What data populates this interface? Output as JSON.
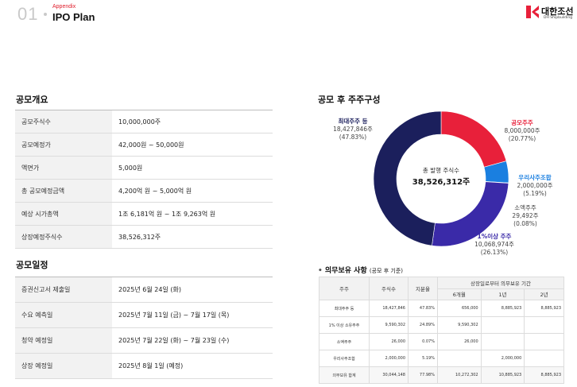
{
  "header": {
    "page_number": "01",
    "section": "Appendix",
    "title": "IPO Plan",
    "logo_kr": "대한조선",
    "logo_en": "DH Shipbuilding"
  },
  "offering": {
    "title": "공모개요",
    "rows": [
      {
        "label": "공모주식수",
        "value": "10,000,000주"
      },
      {
        "label": "공모예정가",
        "value": "42,000원 ~ 50,000원"
      },
      {
        "label": "액면가",
        "value": "5,000원"
      },
      {
        "label": "총 공모예정금액",
        "value": "4,200억 원 ~ 5,000억 원"
      },
      {
        "label": "예상 시가총액",
        "value": "1조 6,181억 원 ~ 1조 9,263억 원"
      },
      {
        "label": "상장예정주식수",
        "value": "38,526,312주"
      }
    ]
  },
  "schedule": {
    "title": "공모일정",
    "rows": [
      {
        "label": "증권신고서 제출일",
        "value": "2025년 6월 24일 (화)"
      },
      {
        "label": "수요 예측일",
        "value": "2025년 7월 11일 (금) ~ 7월 17일 (목)"
      },
      {
        "label": "청약 예정일",
        "value": "2025년 7월 22일 (화) ~ 7월 23일 (수)"
      },
      {
        "label": "상장 예정일",
        "value": "2025년 8월 1일 (예정)"
      }
    ]
  },
  "shareholding": {
    "title": "공모 후 주주구성",
    "center_label": "총 발행 주식수",
    "center_value": "38,526,312주",
    "labels": {
      "largest": {
        "name": "최대주주 등",
        "shares": "18,427,846주",
        "pct": "(47.83%)"
      },
      "public": {
        "name": "공모주주",
        "shares": "8,000,000주",
        "pct": "(20.77%)"
      },
      "esop": {
        "name": "우리사주조합",
        "shares": "2,000,000주",
        "pct": "(5.19%)"
      },
      "minority": {
        "name": "소액주주",
        "shares": "29,492주",
        "pct": "(0.08%)"
      },
      "over1": {
        "name": "1%이상 주주",
        "shares": "10,068,974주",
        "pct": "(26.13%)"
      }
    },
    "colors": {
      "largest": "#1b1f5c",
      "public": "#e8203a",
      "esop": "#1a7fe0",
      "minority": "#cfcfcf",
      "over1": "#3a2aa8"
    }
  },
  "chart_data": {
    "type": "pie",
    "title": "공모 후 주주구성",
    "categories": [
      "공모주주",
      "우리사주조합",
      "소액주주",
      "1%이상 주주",
      "최대주주 등"
    ],
    "values": [
      20.77,
      5.19,
      0.08,
      26.13,
      47.83
    ],
    "shares": [
      8000000,
      2000000,
      29492,
      10068974,
      18427846
    ],
    "total_shares": 38526312
  },
  "lockup": {
    "title": "의무보유 사항",
    "subtitle": "(공모 후 기준)",
    "headers": {
      "holder": "주주",
      "shares": "주식수",
      "ratio": "지분율",
      "period_group": "상장일로부터 의무보유 기간",
      "m6": "6개월",
      "y1": "1년",
      "y2": "2년"
    },
    "rows": [
      {
        "holder": "최대주주 등",
        "shares": "18,427,846",
        "ratio": "47.83%",
        "m6": "656,000",
        "y1": "8,885,923",
        "y2": "8,885,923"
      },
      {
        "holder": "1% 이상 소유주주",
        "shares": "9,590,302",
        "ratio": "24.89%",
        "m6": "9,590,302",
        "y1": "",
        "y2": ""
      },
      {
        "holder": "소액주주",
        "shares": "26,000",
        "ratio": "0.07%",
        "m6": "26,000",
        "y1": "",
        "y2": ""
      },
      {
        "holder": "우리사주조합",
        "shares": "2,000,000",
        "ratio": "5.19%",
        "m6": "",
        "y1": "2,000,000",
        "y2": ""
      },
      {
        "holder": "의무보유 합계",
        "shares": "30,044,148",
        "ratio": "77.98%",
        "m6": "10,272,302",
        "y1": "10,885,923",
        "y2": "8,885,923"
      }
    ]
  }
}
